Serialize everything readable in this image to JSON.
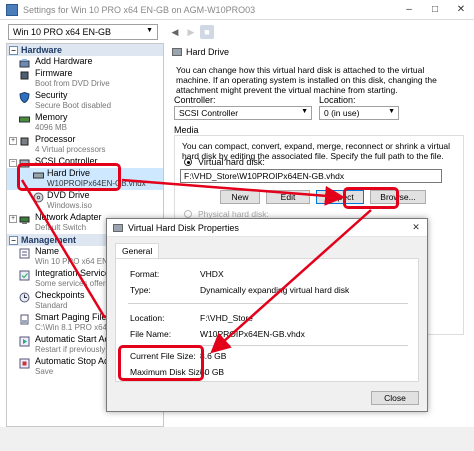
{
  "window": {
    "title": "Settings for Win 10 PRO x64 EN-GB on AGM-W10PRO03",
    "controls": [
      "–",
      "□",
      "✕"
    ]
  },
  "toolbar": {
    "vm_name": "Win 10 PRO x64 EN-GB"
  },
  "tree": {
    "hardware_header": "Hardware",
    "management_header": "Management",
    "hardware": [
      {
        "name": "Add Hardware",
        "sub": ""
      },
      {
        "name": "Firmware",
        "sub": "Boot from DVD Drive"
      },
      {
        "name": "Security",
        "sub": "Secure Boot disabled"
      },
      {
        "name": "Memory",
        "sub": "4096 MB"
      },
      {
        "name": "Processor",
        "sub": "4 Virtual processors"
      },
      {
        "name": "SCSI Controller",
        "sub": ""
      },
      {
        "name": "Hard Drive",
        "sub": "W10PROIPx64EN-GB.vhdx"
      },
      {
        "name": "DVD Drive",
        "sub": "Windows.iso"
      },
      {
        "name": "Network Adapter",
        "sub": "Default Switch"
      }
    ],
    "management": [
      {
        "name": "Name",
        "sub": "Win 10 PRO x64 EN-GB"
      },
      {
        "name": "Integration Services",
        "sub": "Some services offered"
      },
      {
        "name": "Checkpoints",
        "sub": "Standard"
      },
      {
        "name": "Smart Paging File Locat",
        "sub": "C:\\Win 8.1 PRO x64 EN-GB"
      },
      {
        "name": "Automatic Start Action",
        "sub": "Restart if previously runni"
      },
      {
        "name": "Automatic Stop Action",
        "sub": "Save"
      }
    ]
  },
  "pane": {
    "title": "Hard Drive",
    "description": "You can change how this virtual hard disk is attached to the virtual machine. If an operating system is installed on this disk, changing the attachment might prevent the virtual machine from starting.",
    "controller_label": "Controller:",
    "controller_value": "SCSI Controller",
    "location_label": "Location:",
    "location_value": "0 (in use)",
    "media_label": "Media",
    "media_description": "You can compact, convert, expand, merge, reconnect or shrink a virtual hard disk by editing the associated file. Specify the full path to the file.",
    "vhd_radio_label": "Virtual hard disk:",
    "vhd_path": "F:\\VHD_Store\\W10PROIPx64EN-GB.vhdx",
    "new_label": "New",
    "edit_label": "Edit",
    "inspect_label": "Inspect",
    "browse_label": "Browse...",
    "physical_label": "Physical hard disk:"
  },
  "dialog": {
    "title": "Virtual Hard Disk Properties",
    "tab": "General",
    "format_label": "Format:",
    "format_value": "VHDX",
    "type_label": "Type:",
    "type_value": "Dynamically expanding virtual hard disk",
    "location_label": "Location:",
    "location_value": "F:\\VHD_Store",
    "filename_label": "File Name:",
    "filename_value": "W10PROIPx64EN-GB.vhdx",
    "current_size_label": "Current File Size:",
    "current_size_value": "8.6 GB",
    "max_size_label": "Maximum Disk Size:",
    "max_size_value": "50 GB",
    "close_label": "Close",
    "close_glyph": "✕"
  },
  "colors": {
    "annotation": "#e3001b",
    "section_bg": "#dde6f1",
    "selection_bg": "#cde8ff"
  }
}
